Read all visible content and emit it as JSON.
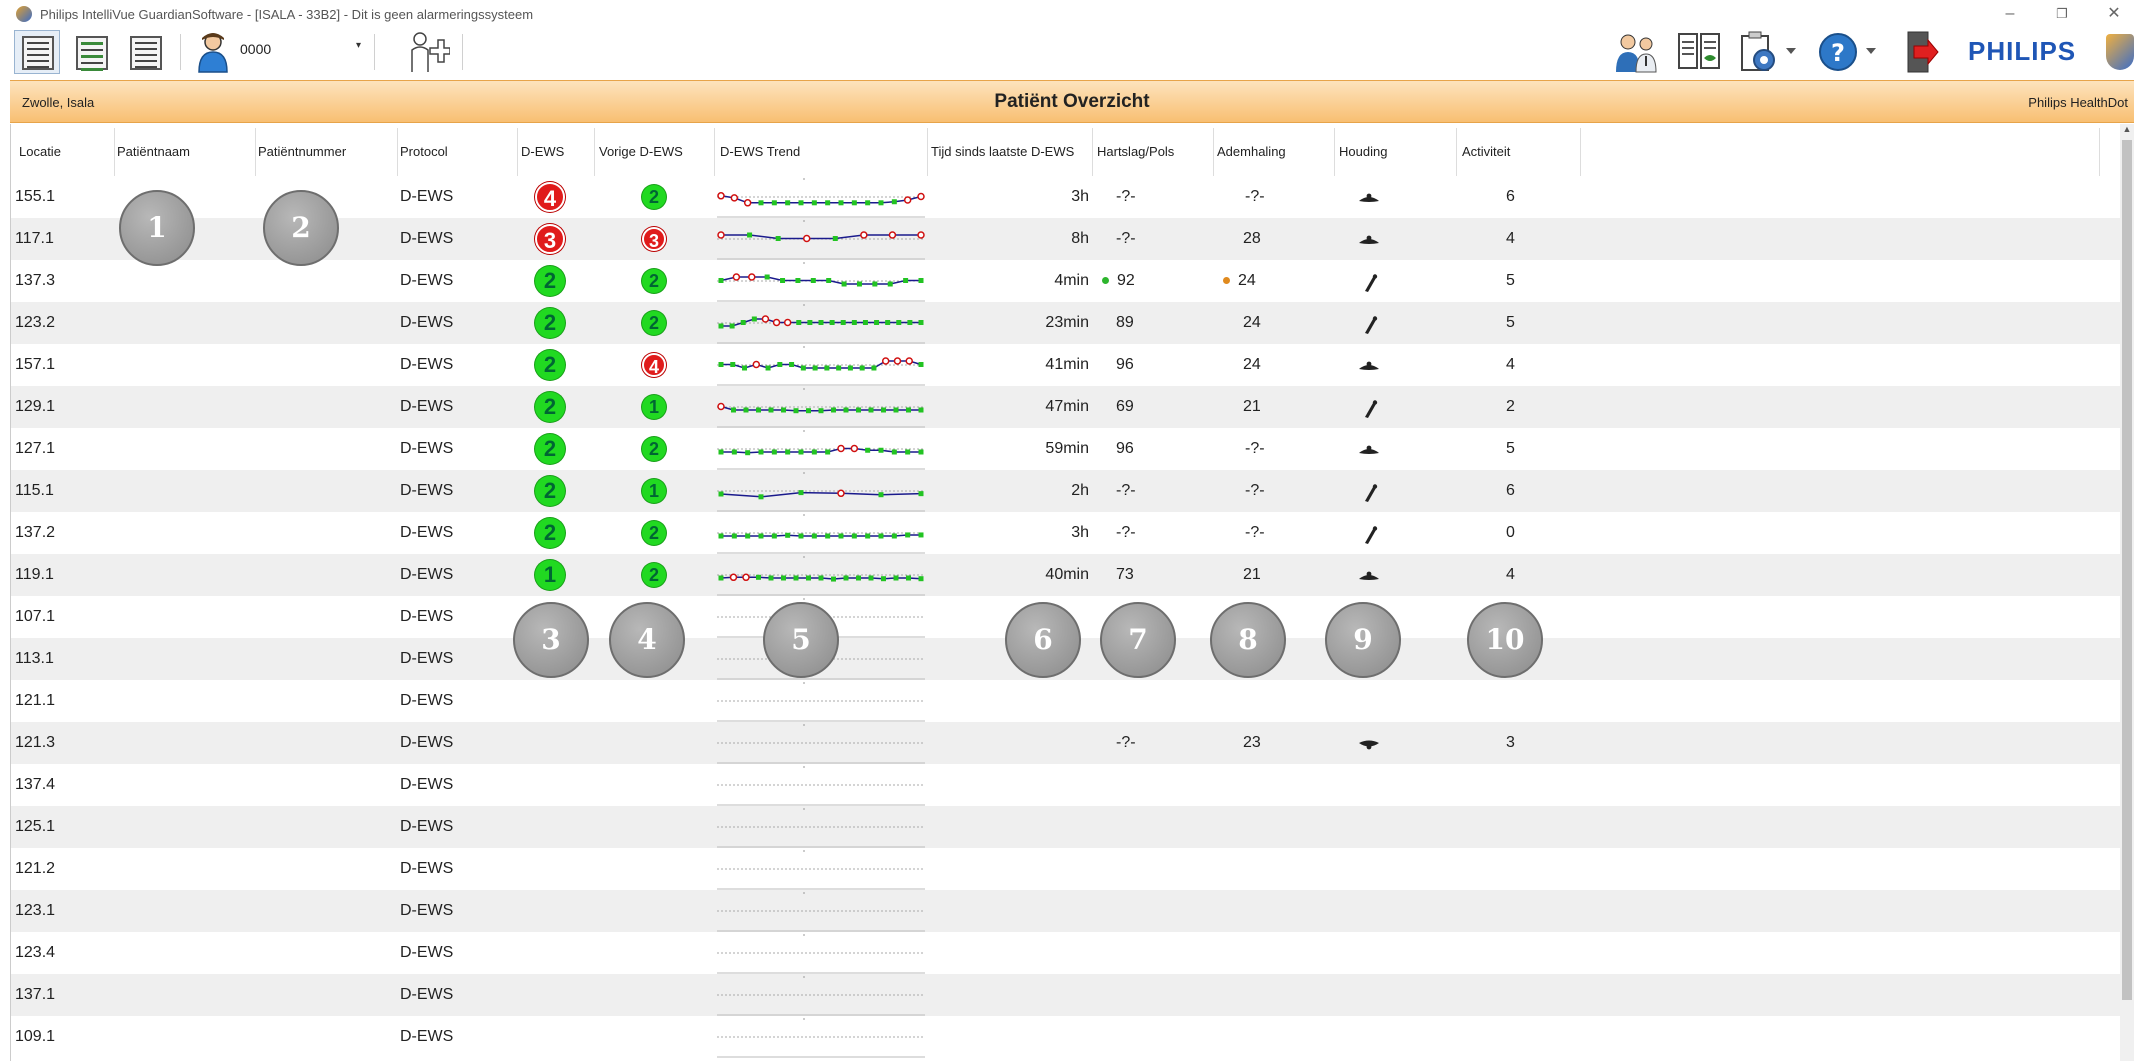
{
  "window": {
    "title": "Philips IntelliVue GuardianSoftware - [ISALA - 33B2] - Dit is geen alarmeringssysteem",
    "minimize": "–",
    "restore": "❐",
    "close": "✕"
  },
  "toolbar": {
    "patient_id": "0000",
    "dropdown_arrow": "▾",
    "brand": "PHILIPS"
  },
  "header": {
    "location": "Zwolle, Isala",
    "title": "Patiënt Overzicht",
    "right": "Philips HealthDot"
  },
  "columns": [
    "Locatie",
    "Patiëntnaam",
    "Patiëntnummer",
    "Protocol",
    "D-EWS",
    "Vorige D-EWS",
    "D-EWS Trend",
    "Tijd sinds laatste D-EWS",
    "Hartslag/Pols",
    "Ademhaling",
    "Houding",
    "Activiteit"
  ],
  "rows": [
    {
      "loc": "155.1",
      "protocol": "D-EWS",
      "dews": "4",
      "dews_color": "red",
      "prev": "2",
      "prev_color": "green",
      "time": "3h",
      "hr": "-?-",
      "resp": "-?-",
      "pose": "lying",
      "act": "6",
      "trend": [
        2.2,
        1.6,
        0.2,
        0.2,
        0.2,
        0.2,
        0.2,
        0.2,
        0.2,
        0.2,
        0.2,
        0.2,
        0.2,
        0.5,
        1.0,
        2.0
      ],
      "trend_red": [
        0,
        1,
        2,
        15,
        14
      ]
    },
    {
      "loc": "117.1",
      "protocol": "D-EWS",
      "dews": "3",
      "dews_color": "red",
      "prev": "3",
      "prev_color": "red",
      "time": "8h",
      "hr": "-?-",
      "resp": "28",
      "pose": "lying",
      "act": "4",
      "trend": [
        3,
        3,
        2,
        2,
        2,
        3,
        3,
        3
      ],
      "trend_red": [
        0,
        5
      ],
      "trend_sparse": [
        0,
        7,
        9,
        10,
        11,
        12,
        13,
        14
      ]
    },
    {
      "loc": "137.3",
      "protocol": "D-EWS",
      "dews": "2",
      "dews_color": "green",
      "prev": "2",
      "prev_color": "green",
      "time": "4min",
      "hr": "92",
      "hr_dot": "#2db52d",
      "resp": "24",
      "resp_dot": "#e08a1e",
      "pose": "upright",
      "act": "5"
    },
    {
      "loc": "123.2",
      "protocol": "D-EWS",
      "dews": "2",
      "dews_color": "green",
      "prev": "2",
      "prev_color": "green",
      "time": "23min",
      "hr": "89",
      "resp": "24",
      "pose": "upright",
      "act": "5"
    },
    {
      "loc": "157.1",
      "protocol": "D-EWS",
      "dews": "2",
      "dews_color": "green",
      "prev": "4",
      "prev_color": "red",
      "time": "41min",
      "hr": "96",
      "resp": "24",
      "pose": "lying",
      "act": "4"
    },
    {
      "loc": "129.1",
      "protocol": "D-EWS",
      "dews": "2",
      "dews_color": "green",
      "prev": "1",
      "prev_color": "green",
      "time": "47min",
      "hr": "69",
      "resp": "21",
      "pose": "upright",
      "act": "2"
    },
    {
      "loc": "127.1",
      "protocol": "D-EWS",
      "dews": "2",
      "dews_color": "green",
      "prev": "2",
      "prev_color": "green",
      "time": "59min",
      "hr": "96",
      "resp": "-?-",
      "pose": "lying",
      "act": "5"
    },
    {
      "loc": "115.1",
      "protocol": "D-EWS",
      "dews": "2",
      "dews_color": "green",
      "prev": "1",
      "prev_color": "green",
      "time": "2h",
      "hr": "-?-",
      "resp": "-?-",
      "pose": "upright",
      "act": "6"
    },
    {
      "loc": "137.2",
      "protocol": "D-EWS",
      "dews": "2",
      "dews_color": "green",
      "prev": "2",
      "prev_color": "green",
      "time": "3h",
      "hr": "-?-",
      "resp": "-?-",
      "pose": "upright",
      "act": "0"
    },
    {
      "loc": "119.1",
      "protocol": "D-EWS",
      "dews": "1",
      "dews_color": "green",
      "prev": "2",
      "prev_color": "green",
      "time": "40min",
      "hr": "73",
      "resp": "21",
      "pose": "lying",
      "act": "4"
    },
    {
      "loc": "107.1",
      "protocol": "D-EWS"
    },
    {
      "loc": "113.1",
      "protocol": "D-EWS"
    },
    {
      "loc": "121.1",
      "protocol": "D-EWS"
    },
    {
      "loc": "121.3",
      "protocol": "D-EWS",
      "hr": "-?-",
      "resp": "23",
      "pose": "lying-down",
      "act": "3"
    },
    {
      "loc": "137.4",
      "protocol": "D-EWS"
    },
    {
      "loc": "125.1",
      "protocol": "D-EWS"
    },
    {
      "loc": "121.2",
      "protocol": "D-EWS"
    },
    {
      "loc": "123.1",
      "protocol": "D-EWS"
    },
    {
      "loc": "123.4",
      "protocol": "D-EWS"
    },
    {
      "loc": "137.1",
      "protocol": "D-EWS"
    },
    {
      "loc": "109.1",
      "protocol": "D-EWS"
    }
  ],
  "callouts": [
    "1",
    "2",
    "3",
    "4",
    "5",
    "6",
    "7",
    "8",
    "9",
    "10"
  ]
}
